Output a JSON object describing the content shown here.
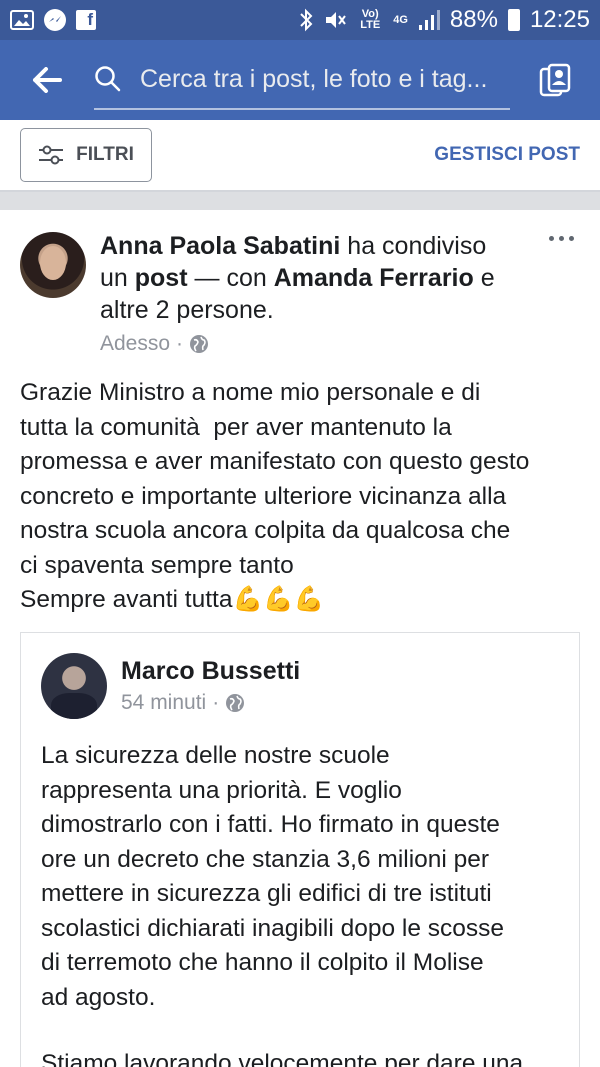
{
  "status_bar": {
    "battery": "88%",
    "time": "12:25",
    "volte_label": "Vo) LTE",
    "network_label": "4G",
    "icons": [
      "gallery-icon",
      "messenger-icon",
      "facebook-icon",
      "bluetooth-icon",
      "mute-icon",
      "volte-icon",
      "network-4g-icon",
      "signal-icon",
      "battery-icon"
    ]
  },
  "header": {
    "search_placeholder": "Cerca tra i post, le foto e i tag..."
  },
  "toolbar": {
    "filters_label": "FILTRI",
    "manage_label": "GESTISCI POST"
  },
  "colors": {
    "header_blue": "#4267b2",
    "status_blue": "#3b5998",
    "link_blue": "#4267b2",
    "meta_gray": "#90949c"
  },
  "post": {
    "author": "Anna Paola Sabatini",
    "action_text": " ha condiviso un ",
    "post_word": "post",
    "with_text": " — con ",
    "tagged": "Amanda Ferrario",
    "others_text": " e altre 2 persone.",
    "time": "Adesso",
    "separator": "·",
    "body": "Grazie Ministro a nome mio personale e di\ntutta la comunità  per aver mantenuto la\npromessa e aver manifestato con questo gesto\nconcreto e importante ulteriore vicinanza alla\nnostra scuola ancora colpita da qualcosa che\nci spaventa sempre tanto\nSempre avanti tutta💪💪💪",
    "shared": {
      "author": "Marco Bussetti",
      "time": "54 minuti",
      "separator": "·",
      "body": "La sicurezza delle nostre scuole\nrappresenta una priorità. E voglio\ndimostrarlo con i fatti. Ho firmato in queste\nore un decreto che stanzia 3,6 milioni per\nmettere in sicurezza gli edifici di tre istituti\nscolastici dichiarati inagibili dopo le scosse\ndi terremoto che hanno il colpito il Molise\nad agosto.",
      "body_continued": "Stiamo lavorando velocemente per dare una"
    }
  }
}
